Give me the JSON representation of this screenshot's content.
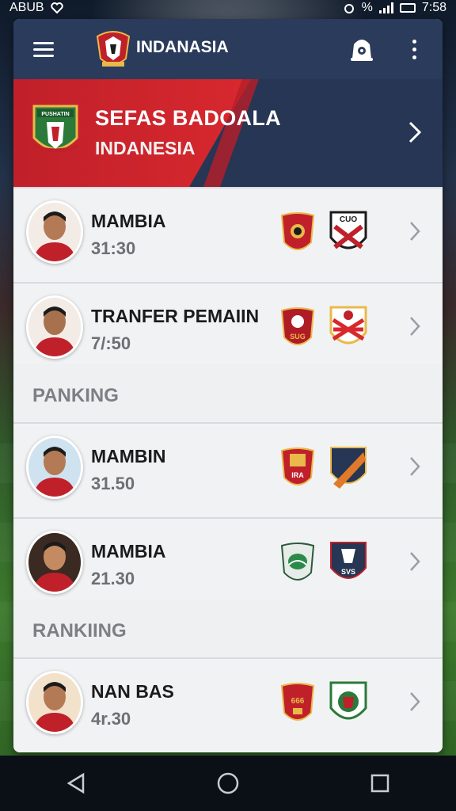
{
  "status_bar": {
    "carrier": "ABUB",
    "extra": "%",
    "time": "7:58"
  },
  "app_bar": {
    "title": "INDANASIA",
    "menu_icon": "hamburger-icon",
    "notify_icon": "bell-icon",
    "more_icon": "more-vertical-icon"
  },
  "hero": {
    "title": "SEFAS BADOALA",
    "subtitle": "INDANESIA",
    "crest_text": "PUSHATIN"
  },
  "rows": [
    {
      "name": "MAMBIA",
      "score": "31:30",
      "badge_text_2": "CUO"
    },
    {
      "name": "TRANFER PEMAIIN",
      "score": "7/:50",
      "badge_text_1": "SUG"
    },
    {
      "name": "MAMBIN",
      "score": "31.50",
      "badge_text_1": "IRA"
    },
    {
      "name": "MAMBIA",
      "score": "21.30",
      "badge_text_2": "SVS"
    },
    {
      "name": "NAN BAS",
      "score": "4r.30",
      "badge_text_1": "666"
    }
  ],
  "sections": {
    "first": "PANKING",
    "second": "RANKIING"
  },
  "nav": {
    "back_icon": "back-triangle-icon",
    "home_icon": "home-circle-icon",
    "recents_icon": "recents-square-icon"
  },
  "colors": {
    "app_bar": "#2a3b5c",
    "hero_red": "#d8282e",
    "hero_navy": "#263654",
    "card_bg": "#eef0f2"
  }
}
